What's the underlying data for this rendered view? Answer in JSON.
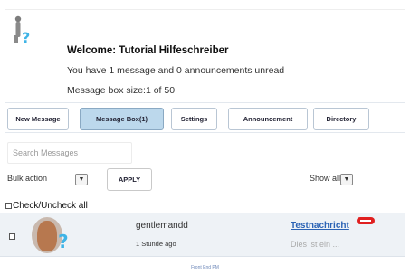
{
  "header": {
    "welcome": "Welcome: Tutorial Hilfeschreiber",
    "unread_line": "You have 1 message and 0 announcements unread",
    "box_size_line": "Message box size:1 of 50"
  },
  "tabs": [
    {
      "label": "New Message"
    },
    {
      "label": "Message Box(1)"
    },
    {
      "label": "Settings"
    },
    {
      "label": "Announcement"
    },
    {
      "label": "Directory"
    }
  ],
  "search": {
    "placeholder": "Search Messages"
  },
  "bulk": {
    "label": "Bulk action",
    "apply_label": "APPLY",
    "show_label": "Show all"
  },
  "check_all_label": "Check/Uncheck all",
  "messages": [
    {
      "sender": "gentlemandd",
      "time_ago": "1 Stunde ago",
      "subject": "Testnachricht",
      "preview": "Dies ist ein ..."
    }
  ],
  "footer_text": "Front End PM",
  "colors": {
    "active_tab": "#bcd8ec",
    "link": "#2b63b5",
    "unread_badge": "#e02020",
    "row_bg": "#eef2f6"
  },
  "icons": {
    "logo": "blue-person-question-icon",
    "unread": "red-unread-badge-icon"
  }
}
